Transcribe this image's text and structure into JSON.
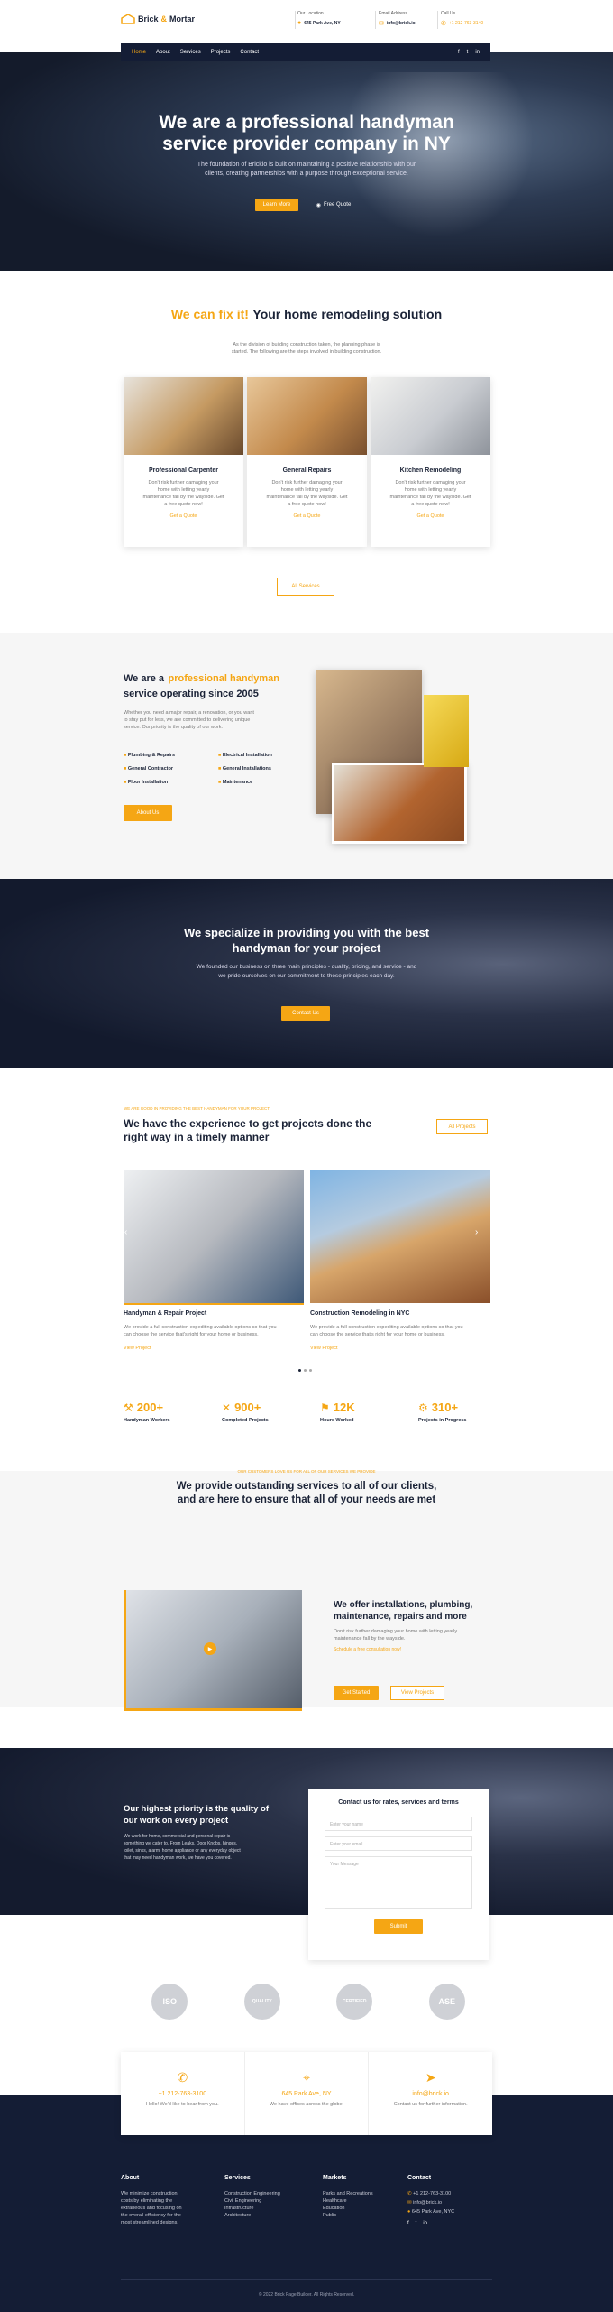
{
  "header": {
    "logo_a": "Brick",
    "logo_amp": "&",
    "logo_b": "Mortar",
    "location_label": "Our Location",
    "location_value": "645 Park Ave, NY",
    "email_label": "Email Address",
    "email_value": "info@brick.io",
    "phone_label": "Call Us",
    "phone_value": "+1 212-763-3140"
  },
  "nav": {
    "items": [
      "Home",
      "About",
      "Services",
      "Projects",
      "Contact"
    ],
    "social": [
      "f",
      "t",
      "in"
    ]
  },
  "hero": {
    "title_line1": "We are a professional handyman",
    "title_line2": "service provider company in NY",
    "sub_line1": "The foundation of Brickio is built on maintaining a positive relationship with our",
    "sub_line2": "clients, creating partnerships with a purpose through exceptional service.",
    "btn_primary": "Learn More",
    "btn_secondary": "Free Quote"
  },
  "fixit": {
    "title_accent": "We can fix it!",
    "title_rest": "Your home remodeling solution",
    "sub_line1": "As the division of building construction taken, the planning phase is",
    "sub_line2": "started. The following are the steps involved in building construction.",
    "cards": [
      {
        "title": "Professional Carpenter",
        "text1": "Don't risk further damaging your",
        "text2": "home with letting yearly",
        "text3": "maintenance fall by the wayside. Get",
        "text4": "a free quote now!",
        "link": "Get a Quote"
      },
      {
        "title": "General Repairs",
        "text1": "Don't risk further damaging your",
        "text2": "home with letting yearly",
        "text3": "maintenance fall by the wayside. Get",
        "text4": "a free quote now!",
        "link": "Get a Quote"
      },
      {
        "title": "Kitchen Remodeling",
        "text1": "Don't risk further damaging your",
        "text2": "home with letting yearly",
        "text3": "maintenance fall by the wayside. Get",
        "text4": "a free quote now!",
        "link": "Get a Quote"
      }
    ],
    "all_services": "All Services"
  },
  "about": {
    "title_a": "We are a",
    "title_accent": "professional handyman",
    "title_b": "service operating since 2005",
    "text1": "Whether you need a major repair, a renovation, or you want",
    "text2": "to stay put for less, we are committed to delivering unique",
    "text3": "service. Our priority is the quality of our work.",
    "features": [
      "Plumbing & Repairs",
      "Electrical Installation",
      "General Contractor",
      "General Installations",
      "Floor Installation",
      "Maintenance"
    ],
    "button": "About Us"
  },
  "specialize": {
    "title1": "We specialize in providing you with the best",
    "title2": "handyman for your project",
    "text1": "We founded our business on three main principles - quality, pricing, and service - and",
    "text2": "we pride ourselves on our commitment to these principles each day.",
    "button": "Contact Us"
  },
  "projects": {
    "eyebrow": "WE ARE GOOD IN PROVIDING THE BEST HANDYMAN FOR YOUR PROJECT",
    "title1": "We have the experience to get projects done the",
    "title2": "right way in a timely manner",
    "all_btn": "All Projects",
    "items": [
      {
        "title": "Handyman & Repair Project",
        "text1": "We provide a full construction expediting available options so that you",
        "text2": "can choose the service that's right for your home or business.",
        "link": "View Project"
      },
      {
        "title": "Construction Remodeling in NYC",
        "text1": "We provide a full construction expediting available options so that you",
        "text2": "can choose the service that's right for your home or business.",
        "link": "View Project"
      }
    ],
    "stats": [
      {
        "value": "200+",
        "label": "Handyman Workers"
      },
      {
        "value": "900+",
        "label": "Completed Projects"
      },
      {
        "value": "12K",
        "label": "Hours Worked"
      },
      {
        "value": "310+",
        "label": "Projects in Progress"
      }
    ]
  },
  "outstanding": {
    "eyebrow": "OUR CUSTOMERS LOVE US FOR ALL OF OUR SERVICES WE PROVIDE",
    "title1": "We provide outstanding services to all of our clients,",
    "title2": "and are here to ensure that all of your needs are met",
    "sub1": "We offer installations, plumbing,",
    "sub2": "maintenance, repairs and more",
    "text1": "Don't risk further damaging your home with letting yearly",
    "text2": "maintenance fall by the wayside.",
    "link": "Schedule a free consultation now!",
    "btn1": "Get Started",
    "btn2": "View Projects"
  },
  "contact": {
    "priority1": "Our highest priority is the quality of",
    "priority2": "our work on every project",
    "ptext1": "We work for home, commercial and personal repair is",
    "ptext2": "something we cater to. From Leaks, Door Knobs, hinges,",
    "ptext3": "toilet, sinks, alarm, home appliance or any everyday object",
    "ptext4": "that may need handyman work, we have you covered.",
    "form_title": "Contact us for rates, services and terms",
    "name_ph": "Enter your name",
    "email_ph": "Enter your email",
    "message_ph": "Your Message",
    "submit": "Submit"
  },
  "certs": [
    "ISO",
    "QUALITY",
    "CERTIFIED",
    "ASE"
  ],
  "info": [
    {
      "value": "+1 212-763-3100",
      "label": "Hello! We'd like to hear from you."
    },
    {
      "value": "645 Park Ave, NY",
      "label": "We have offices across the globe."
    },
    {
      "value": "info@brick.io",
      "label": "Contact us for further information."
    }
  ],
  "footer": {
    "about_title": "About",
    "about_text": [
      "We minimize construction",
      "costs by eliminating the",
      "extraneous and focusing on",
      "the overall efficiency for the",
      "most streamlined designs."
    ],
    "services_title": "Services",
    "services": [
      "Construction Engineering",
      "Civil Engineering",
      "Infrastructure",
      "Architecture"
    ],
    "markets_title": "Markets",
    "markets": [
      "Parks and Recreations",
      "Healthcare",
      "Education",
      "Public"
    ],
    "contact_title": "Contact",
    "contact_phone": "+1 212-763-3100",
    "contact_email": "info@brick.io",
    "contact_addr": "645 Park Ave, NYC",
    "copyright": "© 2022 Brick Page Builder. All Rights Reserved."
  }
}
